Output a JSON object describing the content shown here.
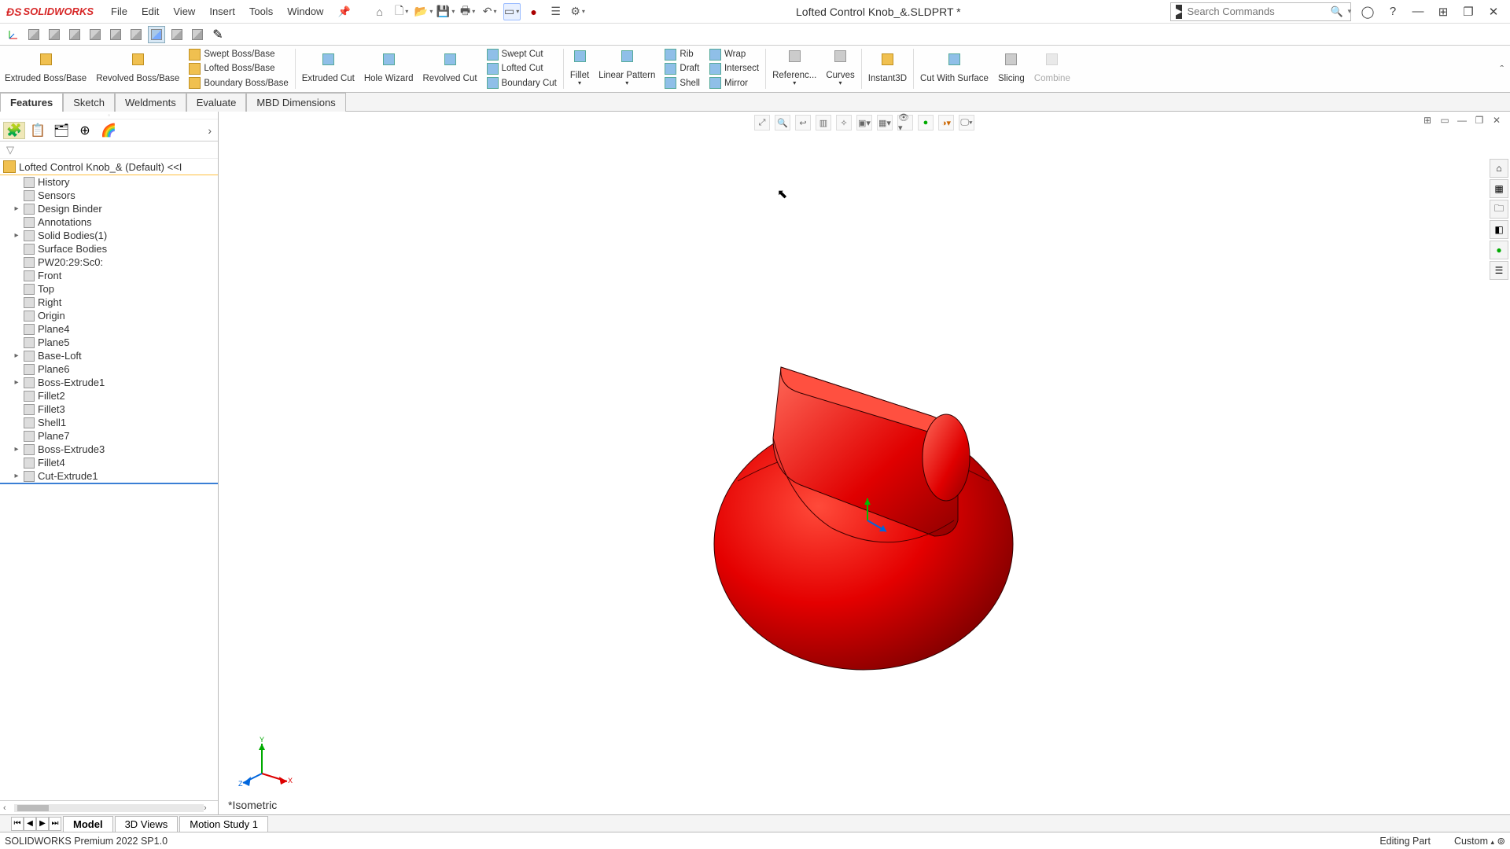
{
  "app": {
    "logo": "SOLIDWORKS",
    "doc_title": "Lofted Control Knob_&.SLDPRT *"
  },
  "menus": [
    "File",
    "Edit",
    "View",
    "Insert",
    "Tools",
    "Window"
  ],
  "search": {
    "placeholder": "Search Commands"
  },
  "ribbon": {
    "tabs": [
      "Features",
      "Sketch",
      "Weldments",
      "Evaluate",
      "MBD Dimensions"
    ],
    "active_tab": "Features",
    "big": {
      "extruded_boss": "Extruded Boss/Base",
      "revolved_boss": "Revolved Boss/Base",
      "extruded_cut": "Extruded Cut",
      "hole_wizard": "Hole Wizard",
      "revolved_cut": "Revolved Cut",
      "fillet": "Fillet",
      "linear_pattern": "Linear Pattern",
      "reference": "Referenc...",
      "curves": "Curves",
      "instant3d": "Instant3D",
      "cut_surface": "Cut With Surface",
      "slicing": "Slicing",
      "combine": "Combine"
    },
    "col1": {
      "swept": "Swept Boss/Base",
      "lofted": "Lofted Boss/Base",
      "boundary": "Boundary Boss/Base"
    },
    "col2": {
      "swept": "Swept Cut",
      "lofted": "Lofted Cut",
      "boundary": "Boundary Cut"
    },
    "col3": {
      "rib": "Rib",
      "draft": "Draft",
      "shell": "Shell"
    },
    "col4": {
      "wrap": "Wrap",
      "intersect": "Intersect",
      "mirror": "Mirror"
    }
  },
  "tree": {
    "root": "Lofted Control Knob_& (Default) <<I",
    "items": [
      {
        "expand": "",
        "label": "History"
      },
      {
        "expand": "",
        "label": "Sensors"
      },
      {
        "expand": "▸",
        "label": "Design Binder"
      },
      {
        "expand": "",
        "label": "Annotations"
      },
      {
        "expand": "▸",
        "label": "Solid Bodies(1)"
      },
      {
        "expand": "",
        "label": "Surface Bodies"
      },
      {
        "expand": "",
        "label": "PW20:29:Sc0:"
      },
      {
        "expand": "",
        "label": "Front"
      },
      {
        "expand": "",
        "label": "Top"
      },
      {
        "expand": "",
        "label": "Right"
      },
      {
        "expand": "",
        "label": "Origin"
      },
      {
        "expand": "",
        "label": "Plane4"
      },
      {
        "expand": "",
        "label": "Plane5"
      },
      {
        "expand": "▸",
        "label": "Base-Loft"
      },
      {
        "expand": "",
        "label": "Plane6"
      },
      {
        "expand": "▸",
        "label": "Boss-Extrude1"
      },
      {
        "expand": "",
        "label": "Fillet2"
      },
      {
        "expand": "",
        "label": "Fillet3"
      },
      {
        "expand": "",
        "label": "Shell1"
      },
      {
        "expand": "",
        "label": "Plane7"
      },
      {
        "expand": "▸",
        "label": "Boss-Extrude3"
      },
      {
        "expand": "",
        "label": "Fillet4"
      },
      {
        "expand": "▸",
        "label": "Cut-Extrude1"
      }
    ]
  },
  "viewport": {
    "orientation_label": "*Isometric"
  },
  "motion_tabs": {
    "model": "Model",
    "views3d": "3D Views",
    "motion1": "Motion Study 1"
  },
  "status": {
    "version": "SOLIDWORKS Premium 2022 SP1.0",
    "mode": "Editing Part",
    "units": "Custom"
  }
}
